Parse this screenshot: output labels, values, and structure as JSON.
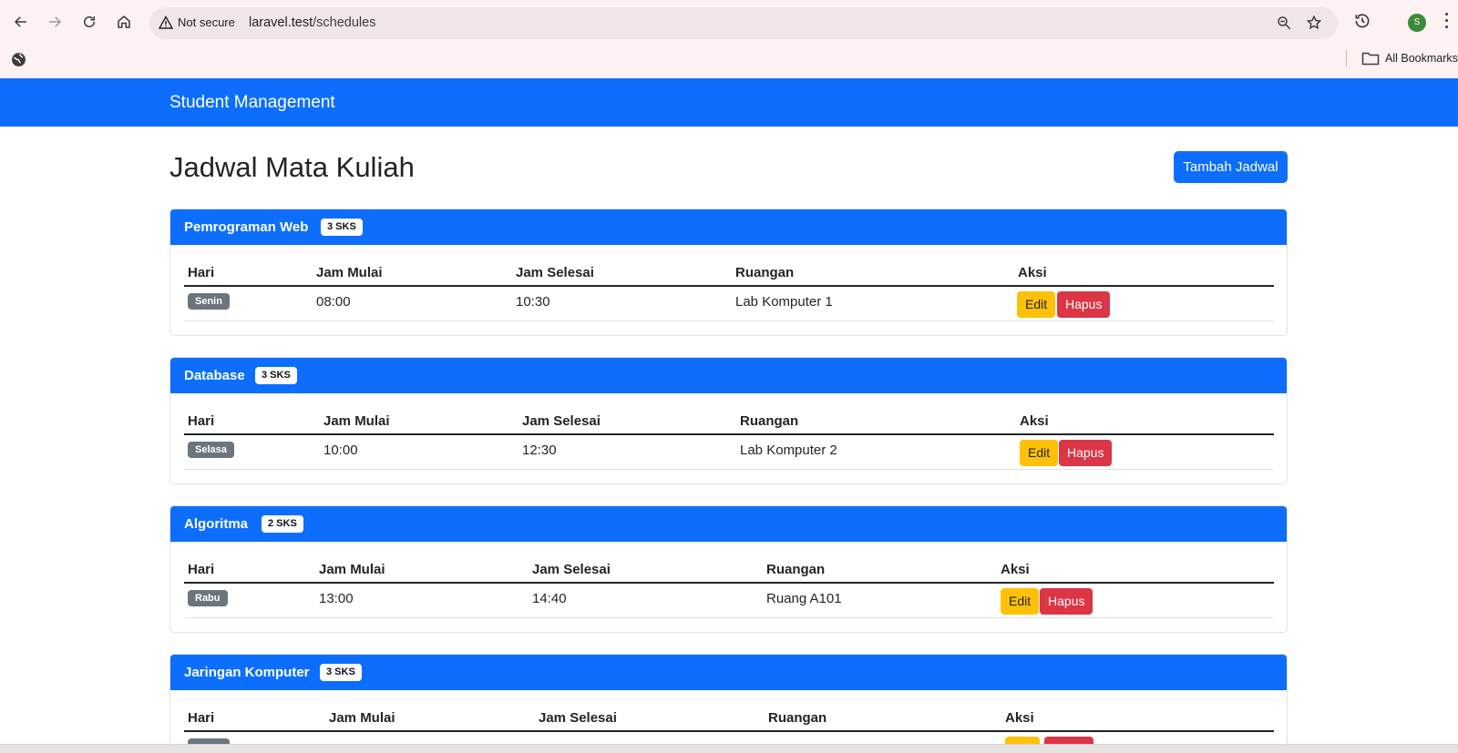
{
  "browser": {
    "security_label": "Not secure",
    "url_host": "laravel.test",
    "url_path": "/schedules",
    "avatar_letter": "S",
    "all_bookmarks_label": "All Bookmarks"
  },
  "navbar": {
    "brand": "Student Management"
  },
  "page": {
    "title": "Jadwal Mata Kuliah",
    "add_button": "Tambah Jadwal"
  },
  "table_headers": {
    "day": "Hari",
    "start": "Jam Mulai",
    "end": "Jam Selesai",
    "room": "Ruangan",
    "action": "Aksi"
  },
  "actions": {
    "edit": "Edit",
    "delete": "Hapus"
  },
  "courses": [
    {
      "name": "Pemrograman Web",
      "sks": "3 SKS",
      "day": "Senin",
      "start": "08:00",
      "end": "10:30",
      "room": "Lab Komputer 1"
    },
    {
      "name": "Database",
      "sks": "3 SKS",
      "day": "Selasa",
      "start": "10:00",
      "end": "12:30",
      "room": "Lab Komputer 2"
    },
    {
      "name": "Algoritma",
      "sks": "2 SKS",
      "day": "Rabu",
      "start": "13:00",
      "end": "14:40",
      "room": "Ruang A101"
    },
    {
      "name": "Jaringan Komputer",
      "sks": "3 SKS",
      "day": "",
      "start": "",
      "end": "",
      "room": ""
    }
  ],
  "colors": {
    "primary": "#0d6efd",
    "warning": "#ffc107",
    "danger": "#dc3545",
    "secondary": "#6c757d"
  },
  "icons": [
    "back-icon",
    "forward-icon",
    "reload-icon",
    "home-icon",
    "warning-icon",
    "zoom-icon",
    "star-icon",
    "history-icon",
    "globe-icon",
    "folder-icon",
    "kebab-menu-icon"
  ]
}
